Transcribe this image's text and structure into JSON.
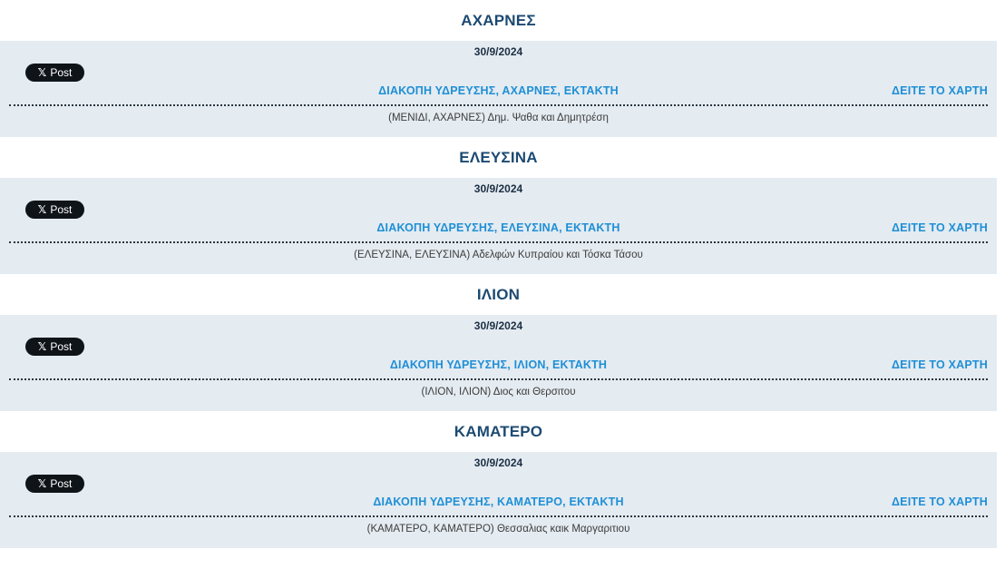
{
  "notices": [
    {
      "area": "ΑΧΑΡΝΕΣ",
      "date": "30/9/2024",
      "post_label": "Post",
      "headline": "ΔΙΑΚΟΠΗ ΥΔΡΕΥΣΗΣ, ΑΧΑΡΝΕΣ, ΕΚΤΑΚΤΗ",
      "map_link": "ΔΕΙΤΕ ΤΟ ΧΑΡΤΗ",
      "detail": "(ΜΕΝΙΔΙ, ΑΧΑΡΝΕΣ) Δημ. Ψαθα και Δημητρέση"
    },
    {
      "area": "ΕΛΕΥΣΙΝΑ",
      "date": "30/9/2024",
      "post_label": "Post",
      "headline": "ΔΙΑΚΟΠΗ ΥΔΡΕΥΣΗΣ, ΕΛΕΥΣΙΝΑ, ΕΚΤΑΚΤΗ",
      "map_link": "ΔΕΙΤΕ ΤΟ ΧΑΡΤΗ",
      "detail": "(ΕΛΕΥΣΙΝΑ, ΕΛΕΥΣΙΝΑ) Αδελφών Κυπραίου και Τόσκα Τάσου"
    },
    {
      "area": "ΙΛΙΟΝ",
      "date": "30/9/2024",
      "post_label": "Post",
      "headline": "ΔΙΑΚΟΠΗ ΥΔΡΕΥΣΗΣ, ΙΛΙΟΝ, ΕΚΤΑΚΤΗ",
      "map_link": "ΔΕΙΤΕ ΤΟ ΧΑΡΤΗ",
      "detail": "(ΙΛΙΟΝ, ΙΛΙΟΝ) Διος και Θερσιτου"
    },
    {
      "area": "ΚΑΜΑΤΕΡΟ",
      "date": "30/9/2024",
      "post_label": "Post",
      "headline": "ΔΙΑΚΟΠΗ ΥΔΡΕΥΣΗΣ, ΚΑΜΑΤΕΡΟ, ΕΚΤΑΚΤΗ",
      "map_link": "ΔΕΙΤΕ ΤΟ ΧΑΡΤΗ",
      "detail": "(ΚΑΜΑΤΕΡΟ, ΚΑΜΑΤΕΡΟ) Θεσσαλιας καικ Μαργαριτιου"
    }
  ]
}
